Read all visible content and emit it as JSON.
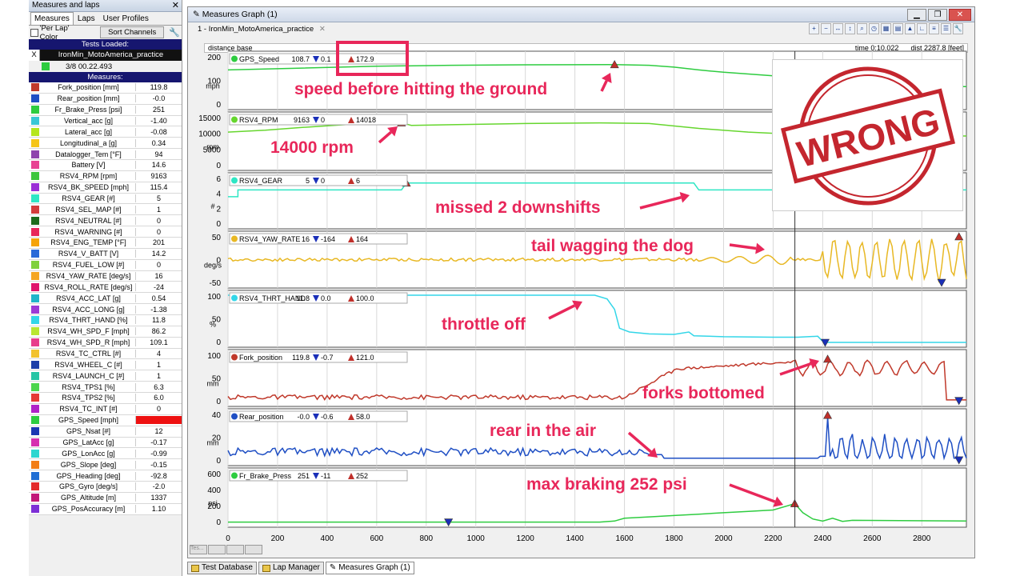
{
  "left_panel": {
    "title": "Measures and laps",
    "close": "✕",
    "tabs": [
      "Measures",
      "Laps",
      "User Profiles"
    ],
    "per_lap_color": "'Per Lap' Color",
    "sort_channels": "Sort Channels",
    "tests_loaded_heading": "Tests Loaded:",
    "test_close": "X",
    "test_name": "IronMin_MotoAmerica_practice",
    "test_time": "3/8 00.22.493",
    "measures_heading": "Measures:",
    "measures": [
      {
        "name": "Fork_position   [mm]",
        "value": "119.8",
        "color": "#c0392b"
      },
      {
        "name": "Rear_position   [mm]",
        "value": "-0.0",
        "color": "#1f4fc4"
      },
      {
        "name": "Fr_Brake_Press   [psi]",
        "value": "251",
        "color": "#2ecc40"
      },
      {
        "name": "Vertical_acc   [g]",
        "value": "-1.40",
        "color": "#39c7d6"
      },
      {
        "name": "Lateral_acc   [g]",
        "value": "-0.08",
        "color": "#b5e61d"
      },
      {
        "name": "Longitudinal_a   [g]",
        "value": "0.34",
        "color": "#f5c518"
      },
      {
        "name": "Datalogger_Tem   [°F]",
        "value": "94",
        "color": "#8e44ad"
      },
      {
        "name": "Battery   [V]",
        "value": "14.6",
        "color": "#e84393"
      },
      {
        "name": "RSV4_RPM   [rpm]",
        "value": "9163",
        "color": "#3ec63e"
      },
      {
        "name": "RSV4_BK_SPEED   [mph]",
        "value": "115.4",
        "color": "#9b2dd6"
      },
      {
        "name": "RSV4_GEAR   [#]",
        "value": "5",
        "color": "#2ee6c4"
      },
      {
        "name": "RSV4_SEL_MAP   [#]",
        "value": "1",
        "color": "#d43c3c"
      },
      {
        "name": "RSV4_NEUTRAL   [#]",
        "value": "0",
        "color": "#1c6b1c"
      },
      {
        "name": "RSV4_WARNING   [#]",
        "value": "0",
        "color": "#e8265a"
      },
      {
        "name": "RSV4_ENG_TEMP   [°F]",
        "value": "201",
        "color": "#f5a30a"
      },
      {
        "name": "RSV4_V_BATT   [V]",
        "value": "14.2",
        "color": "#2a6ad8"
      },
      {
        "name": "RSV4_FUEL_LOW   [#]",
        "value": "0",
        "color": "#7fd13b"
      },
      {
        "name": "RSV4_YAW_RATE   [deg/s]",
        "value": "16",
        "color": "#f5a623"
      },
      {
        "name": "RSV4_ROLL_RATE   [deg/s]",
        "value": "-24",
        "color": "#e0136b"
      },
      {
        "name": "RSV4_ACC_LAT   [g]",
        "value": "0.54",
        "color": "#1fb5c9"
      },
      {
        "name": "RSV4_ACC_LONG   [g]",
        "value": "-1.38",
        "color": "#9d3ad6"
      },
      {
        "name": "RSV4_THRT_HAND   [%]",
        "value": "11.8",
        "color": "#33d6e8"
      },
      {
        "name": "RSV4_WH_SPD_F   [mph]",
        "value": "86.2",
        "color": "#b9e631"
      },
      {
        "name": "RSV4_WH_SPD_R   [mph]",
        "value": "109.1",
        "color": "#e83e8c"
      },
      {
        "name": "RSV4_TC_CTRL   [#]",
        "value": "4",
        "color": "#f2c22e"
      },
      {
        "name": "RSV4_WHEEL_C   [#]",
        "value": "1",
        "color": "#1d3fa8"
      },
      {
        "name": "RSV4_LAUNCH_C   [#]",
        "value": "1",
        "color": "#27c5a5"
      },
      {
        "name": "RSV4_TPS1   [%]",
        "value": "6.3",
        "color": "#4cd64c"
      },
      {
        "name": "RSV4_TPS2   [%]",
        "value": "6.0",
        "color": "#e53935"
      },
      {
        "name": "RSV4_TC_INT   [#]",
        "value": "0",
        "color": "#b022c8"
      },
      {
        "name": "GPS_Speed   [mph]",
        "value": "108.7",
        "color": "#2ecc40",
        "alarm": true
      },
      {
        "name": "GPS_Nsat   [#]",
        "value": "12",
        "color": "#1b37b3"
      },
      {
        "name": "GPS_LatAcc   [g]",
        "value": "-0.17",
        "color": "#d62fb0"
      },
      {
        "name": "GPS_LonAcc   [g]",
        "value": "-0.99",
        "color": "#2ed6d0"
      },
      {
        "name": "GPS_Slope   [deg]",
        "value": "-0.15",
        "color": "#f27d16"
      },
      {
        "name": "GPS_Heading   [deg]",
        "value": "-92.8",
        "color": "#1f6ed4"
      },
      {
        "name": "GPS_Gyro   [deg/s]",
        "value": "-2.0",
        "color": "#e32b2b"
      },
      {
        "name": "GPS_Altitude   [m]",
        "value": "1337",
        "color": "#c21878"
      },
      {
        "name": "GPS_PosAccuracy   [m]",
        "value": "1.10",
        "color": "#7d2fd6"
      }
    ]
  },
  "graph_window": {
    "title": "Measures Graph (1)",
    "doc_tab": "1 - IronMin_MotoAmerica_practice",
    "doc_tab_close": "✕",
    "distance_base": "distance base",
    "time_label": "time 0:10.022",
    "dist_label": "dist 2287.8 [feet]",
    "window_buttons": {
      "minimize": "▁",
      "restore": "❐",
      "close": "✕"
    }
  },
  "chart_data": {
    "type": "line",
    "x_ticks": [
      0,
      200,
      400,
      600,
      800,
      1000,
      1200,
      1400,
      1600,
      1800,
      2000,
      2200,
      2400,
      2600,
      2800
    ],
    "xlim": [
      0,
      2980
    ],
    "cursor_x": 2287.8,
    "panels": [
      {
        "channel": "GPS_Speed",
        "value": "108.7",
        "min_label": "0.1",
        "max_label": "172.9",
        "unit": "mph",
        "yticks": [
          "200",
          "100",
          "0"
        ],
        "ylim": [
          0,
          210
        ],
        "color": "#2ecc40",
        "series": [
          [
            0,
            150
          ],
          [
            300,
            158
          ],
          [
            600,
            166
          ],
          [
            900,
            170
          ],
          [
            1200,
            172
          ],
          [
            1400,
            172.5
          ],
          [
            1560,
            172.9
          ],
          [
            1700,
            170
          ],
          [
            1800,
            162
          ],
          [
            1900,
            150
          ],
          [
            2000,
            140
          ],
          [
            2200,
            125
          ],
          [
            2300,
            110
          ],
          [
            2700,
            80
          ],
          [
            2980,
            78
          ]
        ],
        "max_marker": [
          1560,
          172.9
        ]
      },
      {
        "channel": "RSV4_RPM",
        "value": "9163",
        "min_label": "0",
        "max_label": "14018",
        "unit": "rpm",
        "yticks": [
          "15000",
          "10000",
          "5000",
          "0"
        ],
        "ylim": [
          0,
          16000
        ],
        "color": "#66d62e",
        "series": [
          [
            0,
            11000
          ],
          [
            150,
            11600
          ],
          [
            300,
            12500
          ],
          [
            500,
            13600
          ],
          [
            700,
            14018
          ],
          [
            740,
            13200
          ],
          [
            900,
            13400
          ],
          [
            1200,
            13800
          ],
          [
            1500,
            14000
          ],
          [
            1700,
            13800
          ],
          [
            1900,
            12200
          ],
          [
            2100,
            11000
          ],
          [
            2300,
            10200
          ],
          [
            2500,
            9900
          ],
          [
            2980,
            9700
          ]
        ],
        "max_marker": [
          700,
          14018
        ]
      },
      {
        "channel": "RSV4_GEAR",
        "value": "5",
        "min_label": "0",
        "max_label": "6",
        "unit": "#",
        "yticks": [
          "6",
          "4",
          "2",
          "0"
        ],
        "ylim": [
          0,
          6.8
        ],
        "color": "#2ee6c4",
        "series": [
          [
            0,
            4
          ],
          [
            40,
            4
          ],
          [
            40,
            5
          ],
          [
            700,
            5
          ],
          [
            720,
            6
          ],
          [
            1880,
            6
          ],
          [
            1900,
            5
          ],
          [
            2980,
            5
          ]
        ],
        "max_marker": [
          720,
          6
        ]
      },
      {
        "channel": "RSV4_YAW_RATE",
        "value": "16",
        "min_label": "-164",
        "max_label": "164",
        "unit": "deg/s",
        "yticks": [
          "50",
          "0",
          "-50"
        ],
        "ylim": [
          -60,
          60
        ],
        "color": "#e8b824",
        "series": "yaw",
        "max_marker": [
          2950,
          58
        ],
        "min_marker": [
          2880,
          -58
        ]
      },
      {
        "channel": "RSV4_THRT_HAND",
        "value": "11.8",
        "min_label": "0.0",
        "max_label": "100.0",
        "unit": "%",
        "yticks": [
          "100",
          "50",
          "0"
        ],
        "ylim": [
          0,
          100
        ],
        "color": "#33d6e8",
        "series": [
          [
            0,
            100
          ],
          [
            1480,
            100
          ],
          [
            1530,
            92
          ],
          [
            1560,
            70
          ],
          [
            1580,
            30
          ],
          [
            1620,
            22
          ],
          [
            1700,
            18
          ],
          [
            1800,
            17
          ],
          [
            1860,
            22
          ],
          [
            1880,
            14
          ],
          [
            2000,
            12
          ],
          [
            2200,
            11
          ],
          [
            2300,
            11
          ],
          [
            2380,
            13
          ],
          [
            2395,
            5
          ],
          [
            2410,
            0
          ],
          [
            2980,
            0
          ]
        ],
        "min_marker": [
          2410,
          0
        ]
      },
      {
        "channel": "Fork_position",
        "value": "119.8",
        "min_label": "-0.7",
        "max_label": "121.0",
        "unit": "mm",
        "yticks": [
          "100",
          "50",
          "0"
        ],
        "ylim": [
          -5,
          135
        ],
        "color": "#c0392b",
        "series": "fork",
        "max_marker": [
          2420,
          121
        ],
        "min_marker": [
          2950,
          -2
        ]
      },
      {
        "channel": "Rear_position",
        "value": "-0.0",
        "min_label": "-0.6",
        "max_label": "58.0",
        "unit": "mm",
        "yticks": [
          "40",
          "20",
          "0"
        ],
        "ylim": [
          -3,
          50
        ],
        "color": "#1f4fc4",
        "series": "rear",
        "max_marker": [
          2420,
          48
        ],
        "min_marker": [
          2950,
          -2
        ]
      },
      {
        "channel": "Fr_Brake_Press",
        "value": "251",
        "min_label": "-11",
        "max_label": "252",
        "unit": "psi",
        "yticks": [
          "600",
          "400",
          "200",
          "0"
        ],
        "ylim": [
          -20,
          700
        ],
        "color": "#2ecc40",
        "series": [
          [
            0,
            -15
          ],
          [
            900,
            -15
          ],
          [
            1500,
            -15
          ],
          [
            1560,
            0
          ],
          [
            1600,
            40
          ],
          [
            1700,
            60
          ],
          [
            1800,
            80
          ],
          [
            1900,
            100
          ],
          [
            2000,
            120
          ],
          [
            2100,
            140
          ],
          [
            2200,
            160
          ],
          [
            2287,
            252
          ],
          [
            2320,
            120
          ],
          [
            2360,
            30
          ],
          [
            2400,
            0
          ],
          [
            2440,
            40
          ],
          [
            2480,
            -5
          ],
          [
            2520,
            10
          ],
          [
            2980,
            0
          ]
        ],
        "max_marker": [
          2287,
          252
        ],
        "min_marker": [
          890,
          -15
        ]
      }
    ]
  },
  "annotations": {
    "speed": "speed before hitting the ground",
    "rpm": "14000 rpm",
    "downshifts": "missed 2 downshifts",
    "tail": "tail wagging the dog",
    "throttle": "throttle off",
    "forks": "forks bottomed",
    "rear": "rear in the air",
    "braking": "max braking 252 psi",
    "stamp": "WRONG",
    "color": "#e8275a"
  },
  "bottom_tabs": [
    "Test Database",
    "Lap Manager",
    "Measures Graph (1)"
  ],
  "bottom_strip": [
    "Tes...",
    "",
    "",
    ""
  ]
}
